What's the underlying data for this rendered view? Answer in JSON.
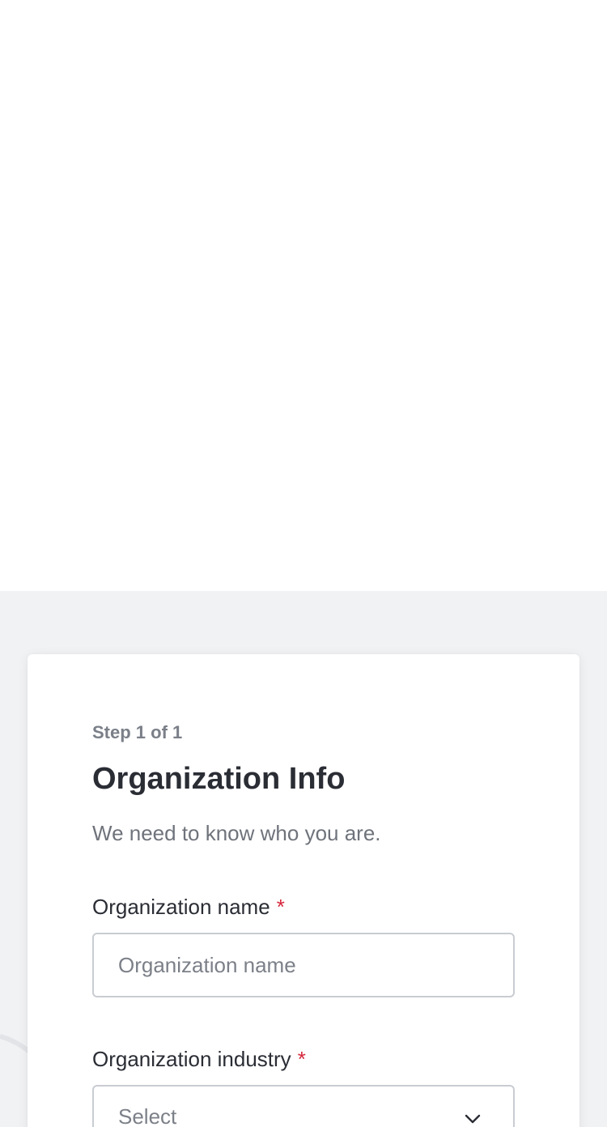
{
  "form": {
    "step": "Step 1 of 1",
    "title": "Organization Info",
    "subtitle": "We need to know who you are.",
    "fields": {
      "name": {
        "label": "Organization name",
        "required_marker": "*",
        "placeholder": "Organization name",
        "value": ""
      },
      "industry": {
        "label": "Organization industry",
        "required_marker": "*",
        "selected": "Select",
        "icon": "chevron-down-icon"
      }
    }
  },
  "colors": {
    "page_background": "#f1f2f4",
    "card_background": "#ffffff",
    "heading": "#2b2d35",
    "muted_text": "#6f737b",
    "required": "#d6253a",
    "input_border": "#c9ccd1"
  }
}
